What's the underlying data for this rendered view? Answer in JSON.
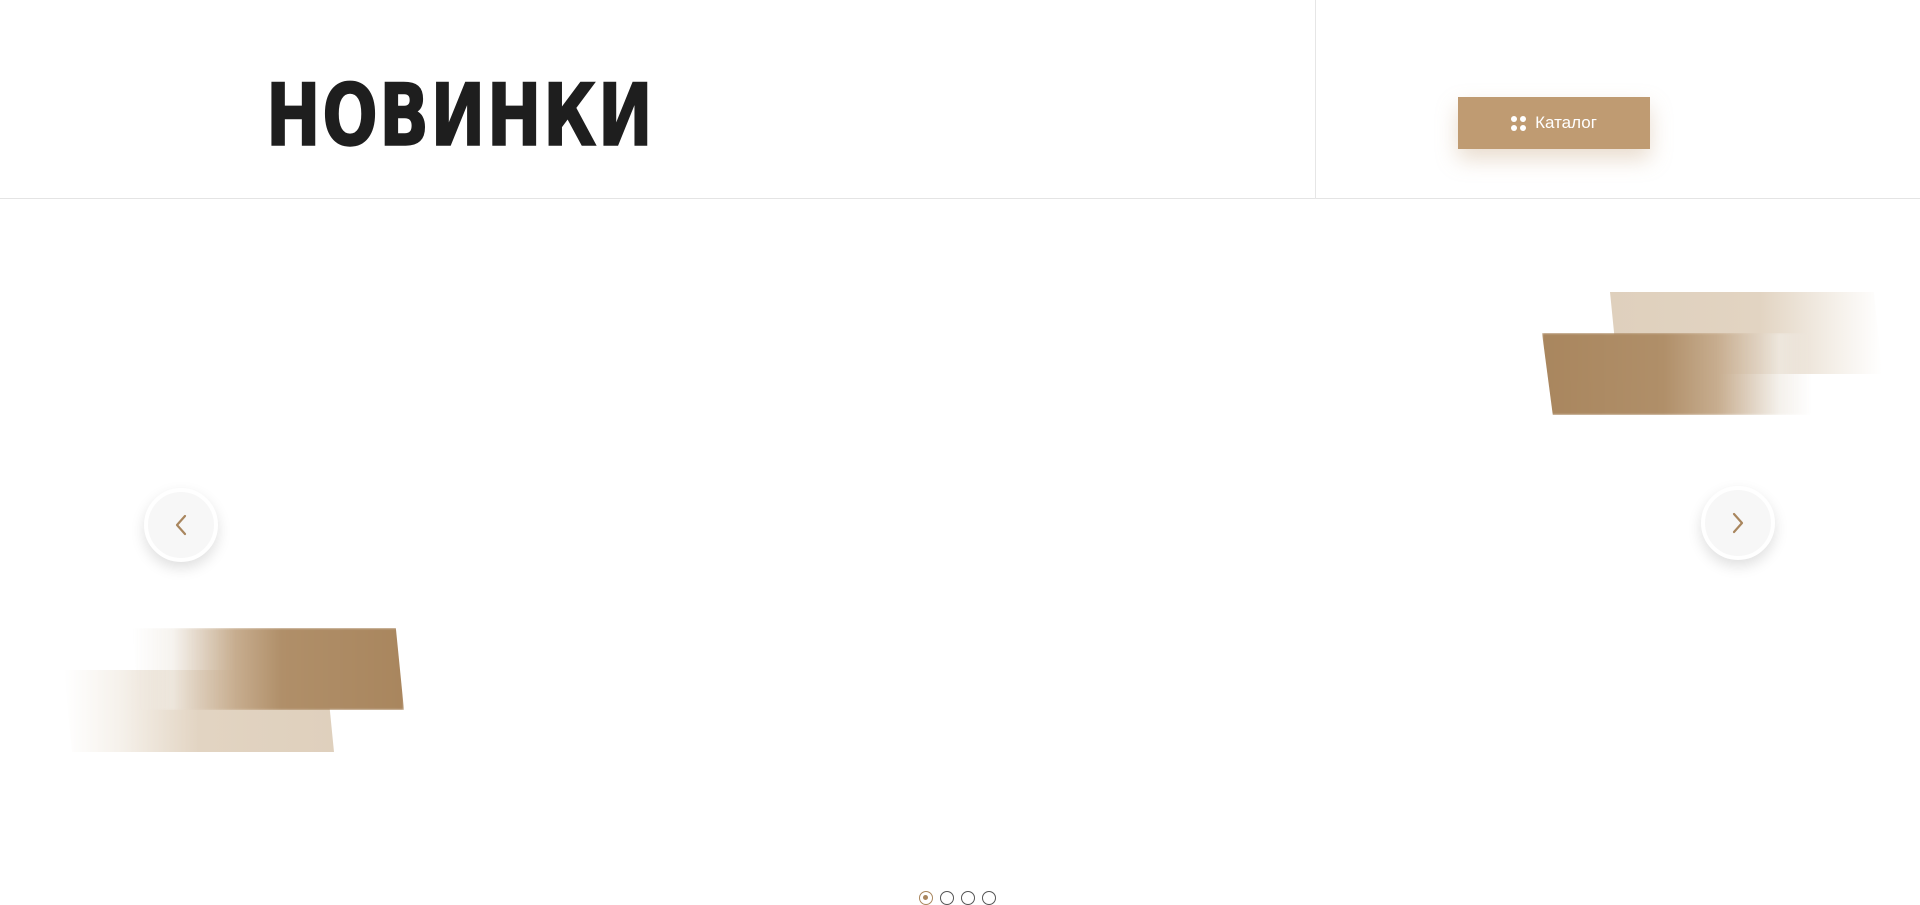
{
  "header": {
    "title": "НОВИНКИ",
    "catalog_button": {
      "label": "Каталог",
      "icon": "grid-dots-icon",
      "color": "#bf9b72"
    }
  },
  "slider": {
    "prev_icon": "chevron-left-icon",
    "next_icon": "chevron-right-icon",
    "accent_color": "#a9865e",
    "pagination": {
      "total": 4,
      "active_index": 0
    }
  }
}
